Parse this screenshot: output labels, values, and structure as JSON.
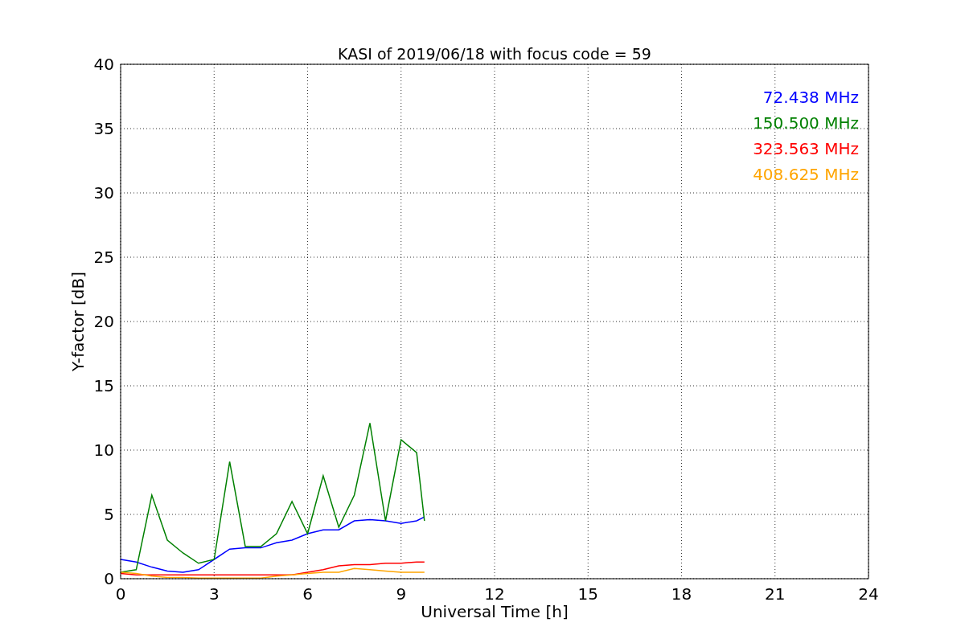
{
  "chart_data": {
    "type": "line",
    "title": "KASI of 2019/06/18 with focus code = 59",
    "xlabel": "Universal Time [h]",
    "ylabel": "Y-factor [dB]",
    "x": [
      0,
      0.5,
      1,
      1.5,
      2,
      2.5,
      3,
      3.5,
      4,
      4.5,
      5,
      5.5,
      6,
      6.5,
      7,
      7.5,
      8,
      8.5,
      9,
      9.5,
      9.75
    ],
    "series": [
      {
        "name": "72.438 MHz",
        "color": "#0000ff",
        "values": [
          1.5,
          1.3,
          0.9,
          0.6,
          0.5,
          0.7,
          1.5,
          2.3,
          2.4,
          2.4,
          2.8,
          3.0,
          3.5,
          3.8,
          3.8,
          4.5,
          4.6,
          4.5,
          4.3,
          4.5,
          4.8
        ]
      },
      {
        "name": "150.500 MHz",
        "color": "#008000",
        "values": [
          0.5,
          0.7,
          6.5,
          3.0,
          2.0,
          1.2,
          1.5,
          9.1,
          2.5,
          2.5,
          3.5,
          6.0,
          3.5,
          8.0,
          4.0,
          6.5,
          12.1,
          4.5,
          10.8,
          9.8,
          4.5
        ]
      },
      {
        "name": "323.563 MHz",
        "color": "#ff0000",
        "values": [
          0.4,
          0.3,
          0.3,
          0.3,
          0.3,
          0.3,
          0.3,
          0.3,
          0.3,
          0.3,
          0.3,
          0.3,
          0.5,
          0.7,
          1.0,
          1.1,
          1.1,
          1.2,
          1.2,
          1.3,
          1.3
        ]
      },
      {
        "name": "408.625 MHz",
        "color": "#ffa500",
        "values": [
          0.5,
          0.4,
          0.2,
          0.1,
          0.1,
          0.05,
          0.05,
          0.05,
          0.05,
          0.05,
          0.2,
          0.3,
          0.4,
          0.5,
          0.5,
          0.8,
          0.7,
          0.6,
          0.5,
          0.5,
          0.5
        ]
      }
    ],
    "xlim": [
      0,
      24
    ],
    "ylim": [
      0,
      40
    ],
    "xticks": [
      0,
      3,
      6,
      9,
      12,
      15,
      18,
      21,
      24
    ],
    "yticks": [
      0,
      5,
      10,
      15,
      20,
      25,
      30,
      35,
      40
    ],
    "grid": true
  }
}
